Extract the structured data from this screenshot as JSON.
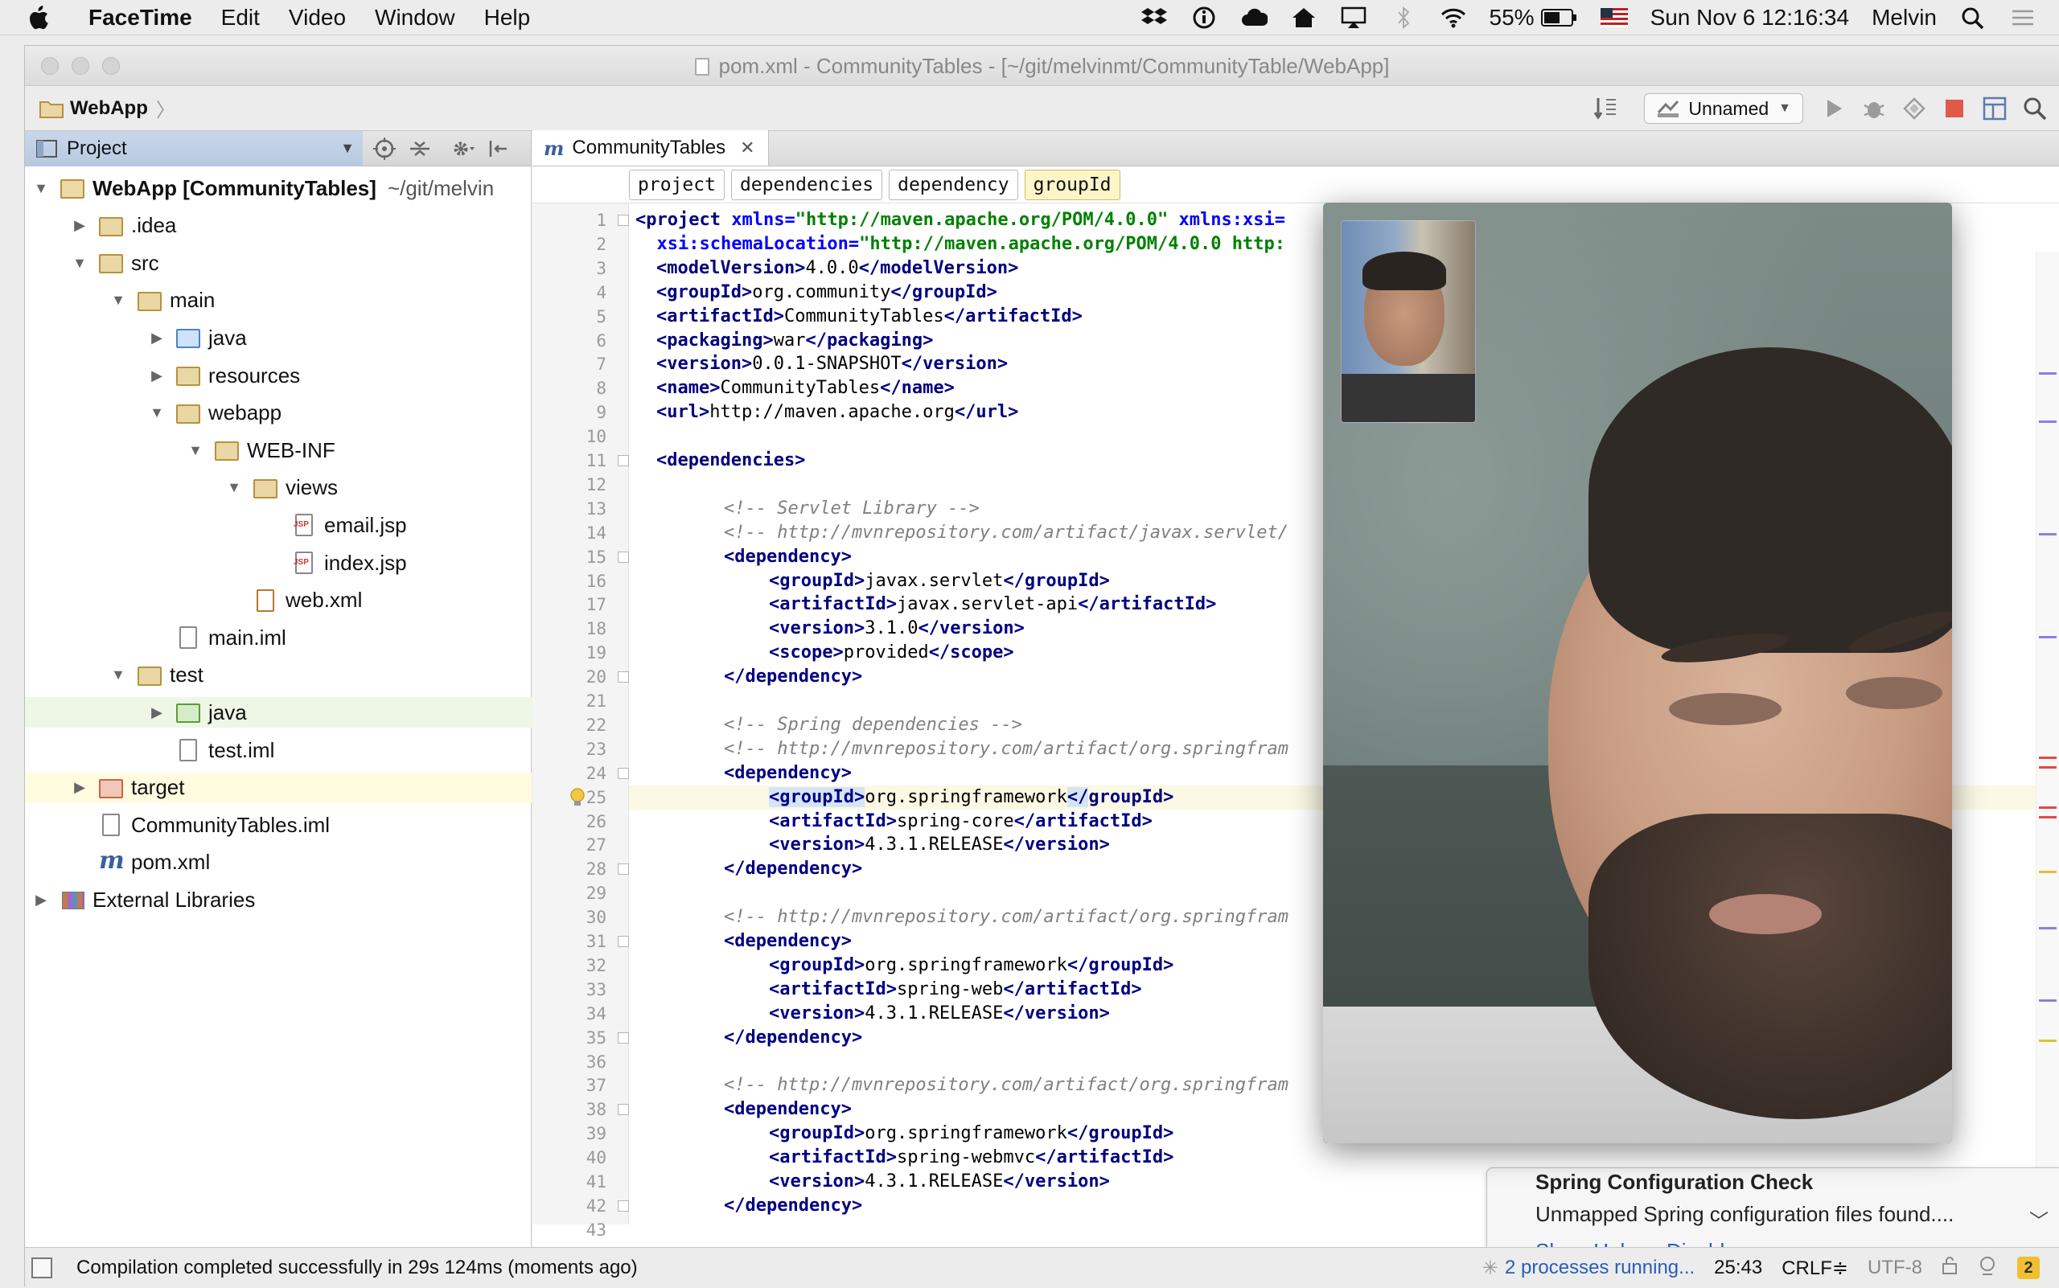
{
  "menubar": {
    "app": "FaceTime",
    "items": [
      "Edit",
      "Video",
      "Window",
      "Help"
    ],
    "battery": "55%",
    "datetime": "Sun Nov 6  12:16:34",
    "user": "Melvin"
  },
  "window": {
    "title": "pom.xml - CommunityTables - [~/git/melvinmt/CommunityTable/WebApp]",
    "nav_crumb": "WebApp",
    "run_config": "Unnamed"
  },
  "project": {
    "header": "Project",
    "tree": [
      {
        "label": "WebApp [CommunityTables]",
        "suffix": "~/git/melvin",
        "arrow": "▼",
        "icon": "multi",
        "indent": 0,
        "bold": true
      },
      {
        "label": ".idea",
        "arrow": "▶",
        "icon": "folder",
        "indent": 1
      },
      {
        "label": "src",
        "arrow": "▼",
        "icon": "folder",
        "indent": 1
      },
      {
        "label": "main",
        "arrow": "▼",
        "icon": "folder",
        "indent": 2
      },
      {
        "label": "java",
        "arrow": "▶",
        "icon": "blue",
        "indent": 3
      },
      {
        "label": "resources",
        "arrow": "▶",
        "icon": "folder",
        "indent": 3
      },
      {
        "label": "webapp",
        "arrow": "▼",
        "icon": "folder",
        "indent": 3
      },
      {
        "label": "WEB-INF",
        "arrow": "▼",
        "icon": "folder",
        "indent": 4
      },
      {
        "label": "views",
        "arrow": "▼",
        "icon": "folder",
        "indent": 5
      },
      {
        "label": "email.jsp",
        "arrow": "",
        "icon": "jsp",
        "indent": 6
      },
      {
        "label": "index.jsp",
        "arrow": "",
        "icon": "jsp",
        "indent": 6
      },
      {
        "label": "web.xml",
        "arrow": "",
        "icon": "xml",
        "indent": 5
      },
      {
        "label": "main.iml",
        "arrow": "",
        "icon": "file",
        "indent": 3
      },
      {
        "label": "test",
        "arrow": "▼",
        "icon": "folder",
        "indent": 2
      },
      {
        "label": "java",
        "arrow": "▶",
        "icon": "green",
        "indent": 3,
        "highlight": "green"
      },
      {
        "label": "test.iml",
        "arrow": "",
        "icon": "file",
        "indent": 3
      },
      {
        "label": "target",
        "arrow": "▶",
        "icon": "red",
        "indent": 1,
        "highlight": "yellow"
      },
      {
        "label": "CommunityTables.iml",
        "arrow": "",
        "icon": "file",
        "indent": 1
      },
      {
        "label": "pom.xml",
        "arrow": "",
        "icon": "m",
        "indent": 1
      },
      {
        "label": "External Libraries",
        "arrow": "▶",
        "icon": "lib",
        "indent": 0
      }
    ]
  },
  "editor": {
    "tab": "CommunityTables",
    "breadcrumbs": [
      "project",
      "dependencies",
      "dependency",
      "groupId"
    ],
    "current_line": 25,
    "lines": [
      {
        "n": 1,
        "i": 0,
        "h": "<t>&lt;project</t> <a>xmlns=</a><s>\"http://maven.apache.org/POM/4.0.0\"</s> <a>xmlns:xsi=</a>"
      },
      {
        "n": 2,
        "i": 0,
        "h": "  <a>xsi:schemaLocation=</a><s>\"http://maven.apache.org/POM/4.0.0 http:</s>"
      },
      {
        "n": 3,
        "i": 1,
        "h": "<t>&lt;modelVersion&gt;</t>4.0.0<t>&lt;/modelVersion&gt;</t>"
      },
      {
        "n": 4,
        "i": 1,
        "h": "<t>&lt;groupId&gt;</t>org.community<t>&lt;/groupId&gt;</t>"
      },
      {
        "n": 5,
        "i": 1,
        "h": "<t>&lt;artifactId&gt;</t>CommunityTables<t>&lt;/artifactId&gt;</t>"
      },
      {
        "n": 6,
        "i": 1,
        "h": "<t>&lt;packaging&gt;</t>war<t>&lt;/packaging&gt;</t>"
      },
      {
        "n": 7,
        "i": 1,
        "h": "<t>&lt;version&gt;</t>0.0.1-SNAPSHOT<t>&lt;/version&gt;</t>"
      },
      {
        "n": 8,
        "i": 1,
        "h": "<t>&lt;name&gt;</t>CommunityTables<t>&lt;/name&gt;</t>"
      },
      {
        "n": 9,
        "i": 1,
        "h": "<t>&lt;url&gt;</t>http://maven.apache.org<t>&lt;/url&gt;</t>"
      },
      {
        "n": 10,
        "i": 0,
        "h": ""
      },
      {
        "n": 11,
        "i": 1,
        "h": "<t>&lt;dependencies&gt;</t>"
      },
      {
        "n": 12,
        "i": 0,
        "h": ""
      },
      {
        "n": 13,
        "i": 2,
        "h": "<c>&lt;!-- Servlet Library --&gt;</c>"
      },
      {
        "n": 14,
        "i": 2,
        "h": "<c>&lt;!-- http://mvnrepository.com/artifact/javax.servlet/</c>"
      },
      {
        "n": 15,
        "i": 2,
        "h": "<t>&lt;dependency&gt;</t>"
      },
      {
        "n": 16,
        "i": 3,
        "h": "<t>&lt;groupId&gt;</t>javax.servlet<t>&lt;/groupId&gt;</t>"
      },
      {
        "n": 17,
        "i": 3,
        "h": "<t>&lt;artifactId&gt;</t>javax.servlet-api<t>&lt;/artifactId&gt;</t>"
      },
      {
        "n": 18,
        "i": 3,
        "h": "<t>&lt;version&gt;</t>3.1.0<t>&lt;/version&gt;</t>"
      },
      {
        "n": 19,
        "i": 3,
        "h": "<t>&lt;scope&gt;</t>provided<t>&lt;/scope&gt;</t>"
      },
      {
        "n": 20,
        "i": 2,
        "h": "<t>&lt;/dependency&gt;</t>"
      },
      {
        "n": 21,
        "i": 0,
        "h": ""
      },
      {
        "n": 22,
        "i": 2,
        "h": "<c>&lt;!-- Spring dependencies --&gt;</c>"
      },
      {
        "n": 23,
        "i": 2,
        "h": "<c>&lt;!-- http://mvnrepository.com/artifact/org.springfram</c>"
      },
      {
        "n": 24,
        "i": 2,
        "h": "<t>&lt;dependency&gt;</t>"
      },
      {
        "n": 25,
        "i": 3,
        "h": "<t><hl>&lt;groupId&gt;</hl></t>org.springframework<t><hl>&lt;/</hl>groupId&gt;</t>"
      },
      {
        "n": 26,
        "i": 3,
        "h": "<t>&lt;artifactId&gt;</t>spring-core<t>&lt;/artifactId&gt;</t>"
      },
      {
        "n": 27,
        "i": 3,
        "h": "<t>&lt;version&gt;</t>4.3.1.RELEASE<t>&lt;/version&gt;</t>"
      },
      {
        "n": 28,
        "i": 2,
        "h": "<t>&lt;/dependency&gt;</t>"
      },
      {
        "n": 29,
        "i": 0,
        "h": ""
      },
      {
        "n": 30,
        "i": 2,
        "h": "<c>&lt;!-- http://mvnrepository.com/artifact/org.springfram</c>"
      },
      {
        "n": 31,
        "i": 2,
        "h": "<t>&lt;dependency&gt;</t>"
      },
      {
        "n": 32,
        "i": 3,
        "h": "<t>&lt;groupId&gt;</t>org.springframework<t>&lt;/groupId&gt;</t>"
      },
      {
        "n": 33,
        "i": 3,
        "h": "<t>&lt;artifactId&gt;</t>spring-web<t>&lt;/artifactId&gt;</t>"
      },
      {
        "n": 34,
        "i": 3,
        "h": "<t>&lt;version&gt;</t>4.3.1.RELEASE<t>&lt;/version&gt;</t>"
      },
      {
        "n": 35,
        "i": 2,
        "h": "<t>&lt;/dependency&gt;</t>"
      },
      {
        "n": 36,
        "i": 0,
        "h": ""
      },
      {
        "n": 37,
        "i": 2,
        "h": "<c>&lt;!-- http://mvnrepository.com/artifact/org.springfram</c>"
      },
      {
        "n": 38,
        "i": 2,
        "h": "<t>&lt;dependency&gt;</t>"
      },
      {
        "n": 39,
        "i": 3,
        "h": "<t>&lt;groupId&gt;</t>org.springframework<t>&lt;/groupId&gt;</t>"
      },
      {
        "n": 40,
        "i": 3,
        "h": "<t>&lt;artifactId&gt;</t>spring-webmvc<t>&lt;/artifactId&gt;</t>"
      },
      {
        "n": 41,
        "i": 3,
        "h": "<t>&lt;version&gt;</t>4.3.1.RELEASE<t>&lt;/version&gt;</t>"
      },
      {
        "n": 42,
        "i": 2,
        "h": "<t>&lt;/dependency&gt;</t>"
      },
      {
        "n": 43,
        "i": 0,
        "h": ""
      }
    ]
  },
  "notification": {
    "title": "Spring Configuration Check",
    "body": "Unmapped Spring configuration files found....",
    "actions": [
      "Show Help",
      "Disable..."
    ]
  },
  "statusbar": {
    "message": "Compilation completed successfully in 29s 124ms (moments ago)",
    "processes": "2 processes running...",
    "position": "25:43",
    "line_sep": "CRLF≑",
    "encoding": "UTF-8",
    "badge": "2"
  },
  "colors": {
    "accent_link": "#2a5cb8",
    "xml_tag": "#000080",
    "xml_attr": "#0000ff",
    "xml_string": "#008000",
    "comment": "#808080"
  }
}
